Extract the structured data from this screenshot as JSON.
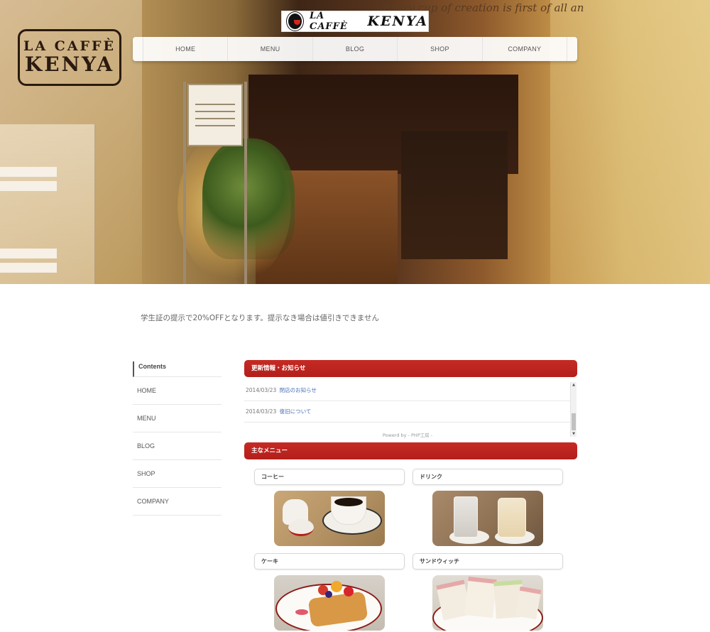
{
  "hero": {
    "wall_logo_line1": "LA CAFFÈ",
    "wall_logo_line2": "KENYA",
    "ad_text": "Every cup of creation is first of all an"
  },
  "logo": {
    "line1": "LA CAFFÈ",
    "line2": "KENYA"
  },
  "nav": {
    "items": [
      "HOME",
      "MENU",
      "BLOG",
      "SHOP",
      "COMPANY"
    ]
  },
  "notice": "学生証の提示で20%OFFとなります。提示なき場合は値引きできません",
  "sidebar": {
    "heading": "Contents",
    "items": [
      "HOME",
      "MENU",
      "BLOG",
      "SHOP",
      "COMPANY"
    ]
  },
  "news": {
    "title": "更新情報・お知らせ",
    "items": [
      {
        "date": "2014/03/23",
        "link": "閉店のお知らせ"
      },
      {
        "date": "2014/03/23",
        "link": "復旧について"
      }
    ],
    "footer": "Powerd by - PHP工房 -"
  },
  "menu": {
    "title": "主なメニュー",
    "items": [
      "コーヒー",
      "ドリンク",
      "ケーキ",
      "サンドウィッチ"
    ]
  },
  "colors": {
    "accent_red": "#b21f1b",
    "link_blue": "#4a6fb5"
  }
}
